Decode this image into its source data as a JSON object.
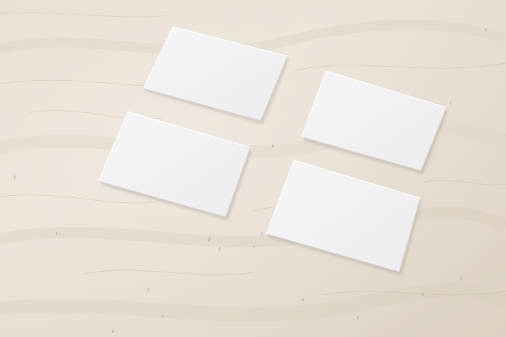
{
  "scene": {
    "surface": "plywood-tabletop",
    "object": "blank-business-card",
    "card_count": 4,
    "colors": {
      "wood_base": "#e7ded2",
      "wood_light": "#efe8de",
      "wood_shade": "#d8cdbf",
      "wood_grain": "#c9bba8",
      "card_face": "#f4f4f5",
      "card_edge": "#ffffff"
    }
  }
}
